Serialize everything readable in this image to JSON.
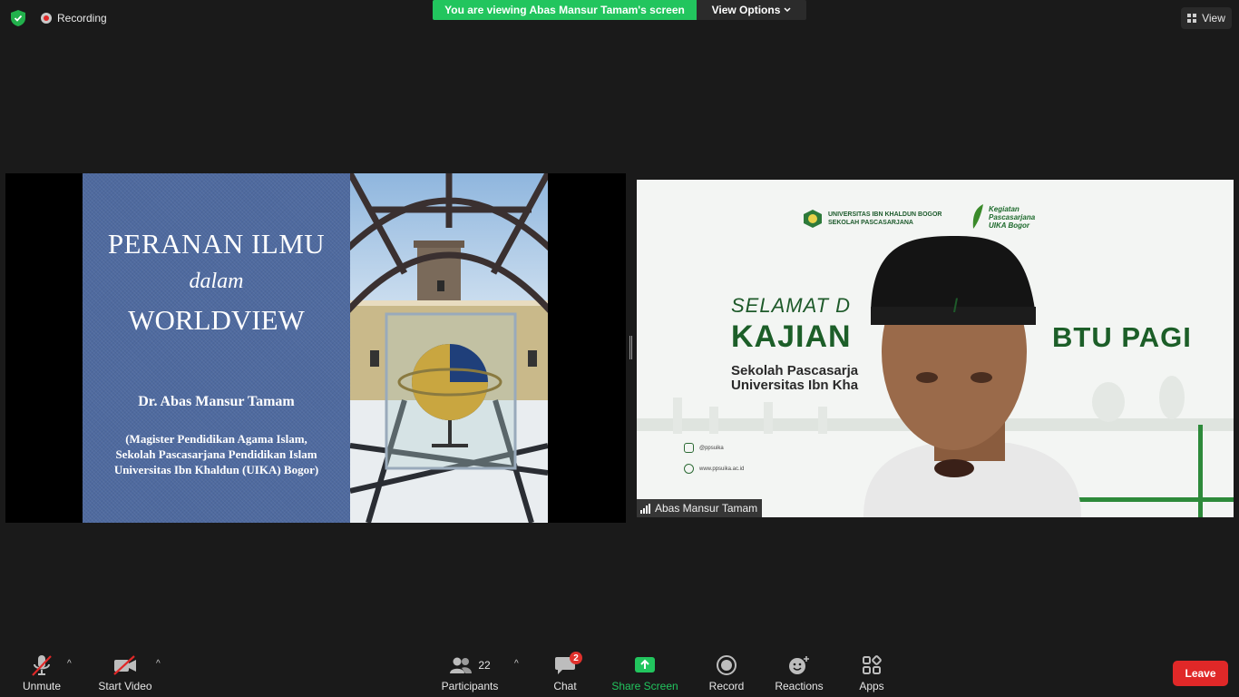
{
  "topbar": {
    "recording_label": "Recording",
    "viewing_banner": "You are viewing Abas Mansur Tamam's screen",
    "view_options_label": "View Options",
    "view_label": "View"
  },
  "shared_slide": {
    "title_line1": "PERANAN ILMU",
    "title_line2": "dalam",
    "title_line3": "WORLDVIEW",
    "author": "Dr. Abas Mansur Tamam",
    "affiliation_line1": "(Magister Pendidikan Agama Islam,",
    "affiliation_line2": "Sekolah Pascasarjana Pendidikan Islam",
    "affiliation_line3": "Universitas Ibn Khaldun (UIKA) Bogor)"
  },
  "video": {
    "org_line1": "UNIVERSITAS IBN KHALDUN BOGOR",
    "org_line2": "SEKOLAH PASCASARJANA",
    "kegiatan_line1": "Kegiatan",
    "kegiatan_line2": "Pascasarjana",
    "kegiatan_line3": "UIKA Bogor",
    "selamat_text": "SELAMAT D",
    "selamat_tail": "I",
    "kajian_text": "KAJIAN",
    "pagi_text": "BTU PAGI",
    "sub_line1": "Sekolah Pascasarja",
    "sub_line2": "Universitas Ibn Kha",
    "instagram": "@ppsuika",
    "website": "www.ppsuika.ac.id",
    "participant_name": "Abas Mansur Tamam"
  },
  "toolbar": {
    "unmute_label": "Unmute",
    "start_video_label": "Start Video",
    "participants_label": "Participants",
    "participants_count": "22",
    "chat_label": "Chat",
    "chat_badge": "2",
    "share_screen_label": "Share Screen",
    "record_label": "Record",
    "reactions_label": "Reactions",
    "apps_label": "Apps",
    "leave_label": "Leave"
  },
  "colors": {
    "accent_green": "#22c55e",
    "leave_red": "#e02828",
    "slide_blue": "#4f6a9f",
    "brand_dark_green": "#1c5e28"
  }
}
